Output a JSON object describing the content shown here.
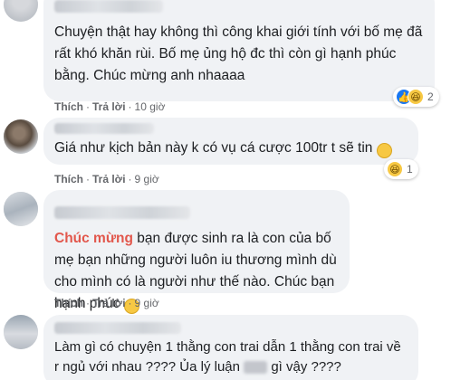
{
  "comments": [
    {
      "text": "Chuyện thật hay không thì công khai giới tính với bố mẹ đã rất khó khăn rùi. Bố mẹ ủng hộ đc thì còn gì hạnh phúc bằng. Chúc mừng anh nhaaaa",
      "like_label": "Thích",
      "reply_label": "Trả lời",
      "time": "10 giờ",
      "reaction_count": "2",
      "reactions": [
        "like-icon",
        "haha-icon"
      ]
    },
    {
      "text": "Giá như kịch bản này k có vụ cá cược 100tr t sẽ tin",
      "like_label": "Thích",
      "reply_label": "Trả lời",
      "time": "9 giờ",
      "reaction_count": "1",
      "reactions": [
        "haha-icon"
      ]
    },
    {
      "highlight": "Chúc mừng",
      "text": " bạn được sinh ra là con của bố mẹ bạn những người luôn iu thương mình dù cho mình có là người như thế nào. Chúc bạn hạnh phúc",
      "like_label": "Thích",
      "reply_label": "Trả lời",
      "time": "9 giờ"
    },
    {
      "text_part1": "Làm gì có chuyện 1 thằng con trai dẫn 1 thằng con trai về r ngủ với nhau ???? Ủa lý luận",
      "text_part2": "gì vậy ????"
    }
  ],
  "colors": {
    "bubble": "#f0f2f5",
    "meta": "#65676b",
    "highlight": "#e2574c",
    "like": "#1877f2"
  }
}
